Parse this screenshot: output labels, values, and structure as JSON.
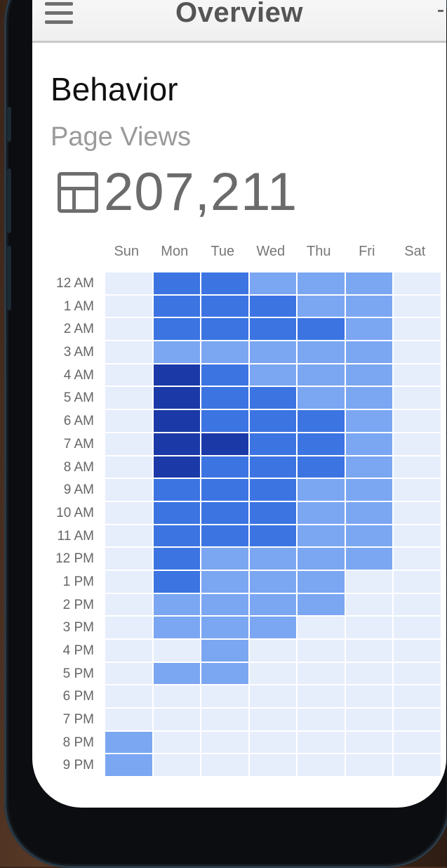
{
  "header": {
    "title": "Overview"
  },
  "behavior": {
    "heading": "Behavior",
    "subheading": "Page Views",
    "metric_value": "207,211"
  },
  "colors": {
    "level0": "#e6edfb",
    "level1": "#7ba6f2",
    "level2": "#3c74e2",
    "level3": "#1b3aa8"
  },
  "heatmap": {
    "days": [
      "Sun",
      "Mon",
      "Tue",
      "Wed",
      "Thu",
      "Fri",
      "Sat"
    ],
    "hours": [
      "12 AM",
      "1 AM",
      "2 AM",
      "3 AM",
      "4 AM",
      "5 AM",
      "6 AM",
      "7 AM",
      "8 AM",
      "9 AM",
      "10 AM",
      "11 AM",
      "12 PM",
      "1 PM",
      "2 PM",
      "3 PM",
      "4 PM",
      "5 PM",
      "6 PM",
      "7 PM",
      "8 PM",
      "9 PM"
    ],
    "levels": [
      [
        0,
        2,
        2,
        1,
        1,
        1,
        0
      ],
      [
        0,
        2,
        2,
        2,
        1,
        1,
        0
      ],
      [
        0,
        2,
        2,
        2,
        2,
        1,
        0
      ],
      [
        0,
        1,
        1,
        1,
        1,
        1,
        0
      ],
      [
        0,
        3,
        2,
        1,
        1,
        1,
        0
      ],
      [
        0,
        3,
        2,
        2,
        1,
        1,
        0
      ],
      [
        0,
        3,
        2,
        2,
        2,
        1,
        0
      ],
      [
        0,
        3,
        3,
        2,
        2,
        1,
        0
      ],
      [
        0,
        3,
        2,
        2,
        2,
        1,
        0
      ],
      [
        0,
        2,
        2,
        2,
        1,
        1,
        0
      ],
      [
        0,
        2,
        2,
        2,
        1,
        1,
        0
      ],
      [
        0,
        2,
        2,
        2,
        1,
        1,
        0
      ],
      [
        0,
        2,
        1,
        1,
        1,
        1,
        0
      ],
      [
        0,
        2,
        1,
        1,
        1,
        0,
        0
      ],
      [
        0,
        1,
        1,
        1,
        1,
        0,
        0
      ],
      [
        0,
        1,
        1,
        1,
        0,
        0,
        0
      ],
      [
        0,
        0,
        1,
        0,
        0,
        0,
        0
      ],
      [
        0,
        1,
        1,
        0,
        0,
        0,
        0
      ],
      [
        0,
        0,
        0,
        0,
        0,
        0,
        0
      ],
      [
        0,
        0,
        0,
        0,
        0,
        0,
        0
      ],
      [
        1,
        0,
        0,
        0,
        0,
        0,
        0
      ],
      [
        1,
        0,
        0,
        0,
        0,
        0,
        0
      ]
    ]
  },
  "icons": {
    "menu": "hamburger-menu-icon",
    "metric": "table-layout-icon",
    "signal": "signal-icon",
    "wifi": "wifi-icon",
    "battery": "battery-icon"
  }
}
